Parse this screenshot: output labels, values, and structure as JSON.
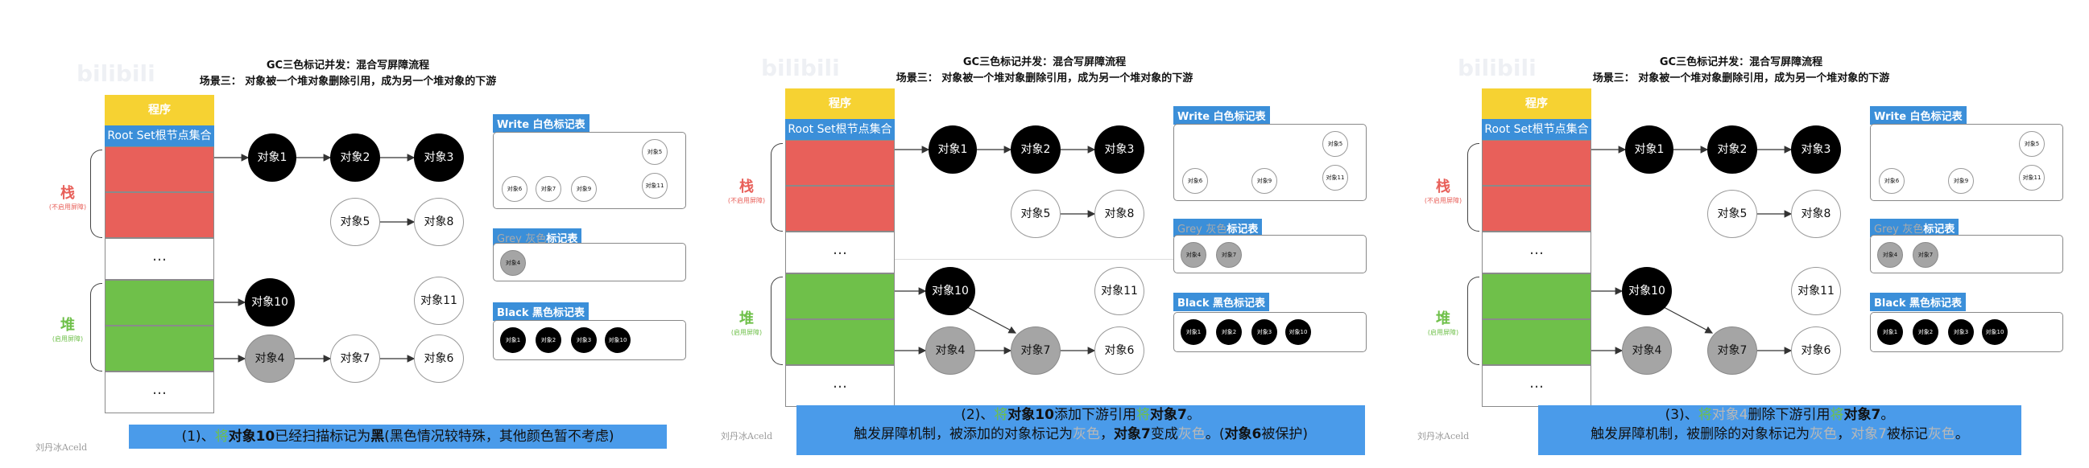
{
  "common": {
    "title_line1": "GC三色标记并发：混合写屏障流程",
    "title_line2": "场景三： 对象被一个堆对象删除引用，成为另一个堆对象的下游",
    "program": "程序",
    "root_set": "Root Set根节点集合",
    "stack_label": "栈",
    "stack_sub": "(不启用屏障)",
    "heap_label": "堆",
    "heap_sub": "(启用屏障)",
    "ellipsis": "…",
    "legend_white_en": "Write",
    "legend_white_cn": "白色",
    "legend_grey_en": "Grey",
    "legend_grey_cn": "灰色",
    "legend_black_en": "Black",
    "legend_black_cn": "黑色",
    "legend_suffix": "标记表",
    "logo": "bilibili",
    "signature": "刘丹冰Aceld"
  },
  "nodes": {
    "n1": "对象1",
    "n2": "对象2",
    "n3": "对象3",
    "n4": "对象4",
    "n5": "对象5",
    "n6": "对象6",
    "n7": "对象7",
    "n8": "对象8",
    "n9": "对象9",
    "n10": "对象10",
    "n11": "对象11"
  },
  "panels": [
    {
      "caption": {
        "prefix": "(1)、",
        "p1": "将",
        "p2": "对象10",
        "p3": "已经扫描标记为",
        "p4": "黑",
        "p5": "(黑色情况较特殊，其他颜色暂不考虑)"
      }
    },
    {
      "caption": {
        "line1_prefix": "(2)、",
        "l1a": "将",
        "l1b": "对象10",
        "l1c": "添加下游引用",
        "l1d": "将",
        "l1e": "对象7",
        "l1f": "。",
        "l2a": "触发屏障机制，被添加的对象标记为",
        "l2b": "灰色",
        "l2c": "，",
        "l2d": "对象7",
        "l2e": "变成",
        "l2f": "灰色",
        "l2g": "。(",
        "l2h": "对象6",
        "l2i": "被保护)"
      }
    },
    {
      "caption": {
        "line1_prefix": "(3)、",
        "l1a": "将",
        "l1b": "对象4",
        "l1c": "删除下游引用",
        "l1d": "将",
        "l1e": "对象7",
        "l1f": "。",
        "l2a": "触发屏障机制，被删除的对象标记为",
        "l2b": "灰色",
        "l2c": "，",
        "l2d": "对象7",
        "l2e": "被标记",
        "l2f": "灰色",
        "l2g": "。"
      }
    }
  ]
}
